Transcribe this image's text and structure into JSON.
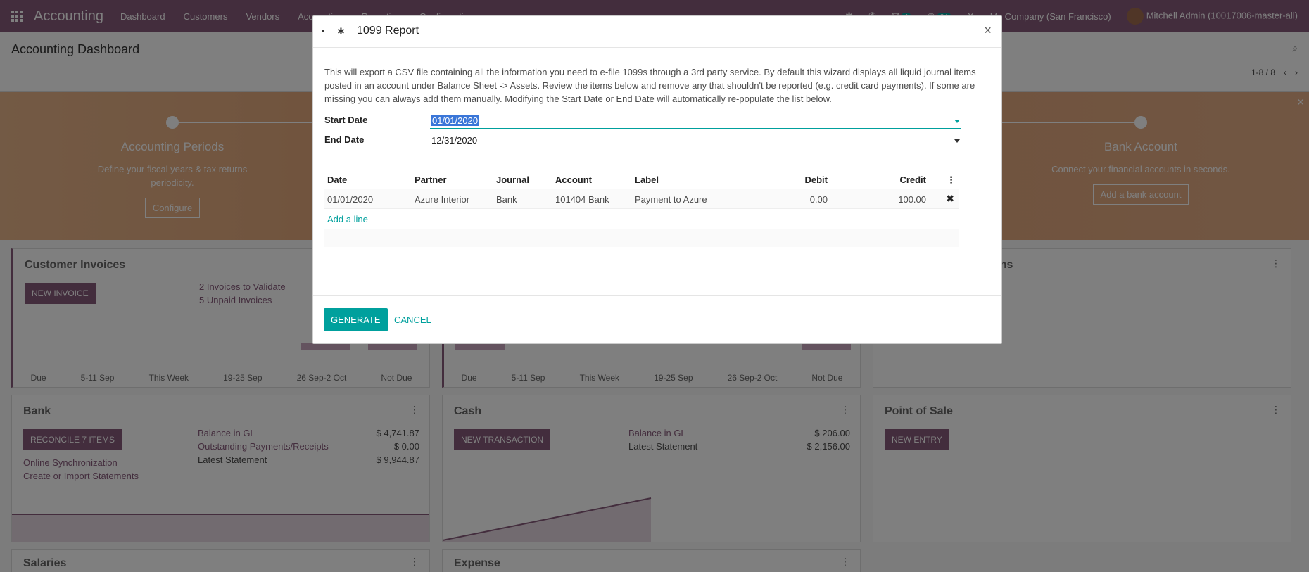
{
  "navbar": {
    "brand": "Accounting",
    "menu": [
      "Dashboard",
      "Customers",
      "Vendors",
      "Accounting",
      "Reporting",
      "Configuration"
    ],
    "messages_badge": "4",
    "activities_badge": "24",
    "company": "My Company (San Francisco)",
    "user": "Mitchell Admin (10017006-master-all)"
  },
  "control_panel": {
    "title": "Accounting Dashboard",
    "pager": "1-8 / 8"
  },
  "banner": {
    "steps": [
      {
        "title": "Accounting Periods",
        "desc": "Define your fiscal years & tax returns periodicity.",
        "button": "Configure"
      },
      {
        "title": "Bank Account",
        "desc": "Connect your financial accounts in seconds.",
        "button": "Add a bank account"
      }
    ]
  },
  "dashboard": {
    "customer_invoices": {
      "title": "Customer Invoices",
      "button": "NEW INVOICE",
      "links": [
        "2 Invoices to Validate",
        "5 Unpaid Invoices"
      ],
      "chart_labels": [
        "Due",
        "5-11 Sep",
        "This Week",
        "19-25 Sep",
        "26 Sep-2 Oct",
        "Not Due"
      ]
    },
    "vendor_bills": {
      "title_tail": "ons",
      "chart_labels": [
        "Due",
        "5-11 Sep",
        "This Week",
        "19-25 Sep",
        "26 Sep-2 Oct",
        "Not Due"
      ]
    },
    "bank": {
      "title": "Bank",
      "button": "RECONCILE 7 ITEMS",
      "links": [
        "Online Synchronization",
        "Create or Import Statements"
      ],
      "rows": [
        {
          "label": "Balance in GL",
          "value": "$ 4,741.87"
        },
        {
          "label": "Outstanding Payments/Receipts",
          "value": "$ 0.00"
        },
        {
          "label": "Latest Statement",
          "value": "$ 9,944.87"
        }
      ]
    },
    "cash": {
      "title": "Cash",
      "button": "NEW TRANSACTION",
      "rows": [
        {
          "label": "Balance in GL",
          "value": "$ 206.00"
        },
        {
          "label": "Latest Statement",
          "value": "$ 2,156.00"
        }
      ]
    },
    "pos": {
      "title": "Point of Sale",
      "button": "NEW ENTRY"
    },
    "salaries": {
      "title": "Salaries"
    },
    "expense": {
      "title": "Expense"
    }
  },
  "modal": {
    "title": "1099 Report",
    "intro": "This will export a CSV file containing all the information you need to e-file 1099s through a 3rd party service. By default this wizard displays all liquid journal items posted in an account under Balance Sheet -> Assets. Review the items below and remove any that shouldn't be reported (e.g. credit card payments). If some are missing you can always add them manually. Modifying the Start Date or End Date will automatically re-populate the list below.",
    "start_date_label": "Start Date",
    "start_date": "01/01/2020",
    "end_date_label": "End Date",
    "end_date": "12/31/2020",
    "columns": {
      "date": "Date",
      "partner": "Partner",
      "journal": "Journal",
      "account": "Account",
      "label": "Label",
      "debit": "Debit",
      "credit": "Credit"
    },
    "lines": [
      {
        "date": "01/01/2020",
        "partner": "Azure Interior",
        "journal": "Bank",
        "account": "101404 Bank",
        "label": "Payment to Azure",
        "debit": "0.00",
        "credit": "100.00"
      }
    ],
    "add_line": "Add a line",
    "generate": "GENERATE",
    "cancel": "CANCEL"
  }
}
